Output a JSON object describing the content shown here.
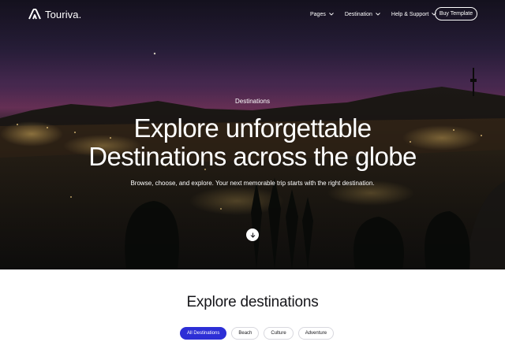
{
  "brand": {
    "name": "Touriva."
  },
  "nav": {
    "items": [
      {
        "label": "Pages"
      },
      {
        "label": "Destination"
      },
      {
        "label": "Help & Support"
      }
    ],
    "cta_label": "Buy Template"
  },
  "hero": {
    "eyebrow": "Destinations",
    "headline_line1": "Explore unforgettable",
    "headline_line2": "Destinations across the globe",
    "subtitle": "Browse, choose, and explore. Your next memorable trip starts with the right destination."
  },
  "explore": {
    "title": "Explore destinations",
    "filters": [
      {
        "label": "All Destinations",
        "active": true
      },
      {
        "label": "Beach",
        "active": false
      },
      {
        "label": "Culture",
        "active": false
      },
      {
        "label": "Adventure",
        "active": false
      }
    ]
  },
  "colors": {
    "accent": "#2d2fd6",
    "text": "#16161a",
    "white": "#ffffff"
  },
  "icons": {
    "logo": "touriva-logo-icon",
    "dropdown": "chevron-down-icon",
    "scroll": "arrow-down-icon"
  }
}
